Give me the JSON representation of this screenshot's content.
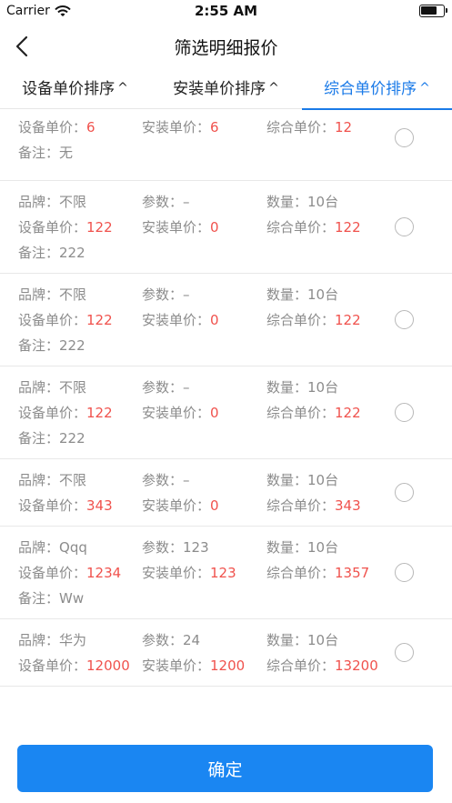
{
  "status_bar": {
    "carrier": "Carrier",
    "time": "2:55 AM",
    "battery_level": 0.75
  },
  "nav": {
    "title": "筛选明细报价"
  },
  "tabs": [
    {
      "label": "设备单价排序",
      "arrow": "^",
      "active": false
    },
    {
      "label": "安装单价排序",
      "arrow": "^",
      "active": false
    },
    {
      "label": "综合单价排序",
      "arrow": "^",
      "active": true
    }
  ],
  "labels": {
    "brand": "品牌：",
    "param": "参数：",
    "qty": "数量：",
    "equip_price": "设备单价：",
    "install_price": "安装单价：",
    "total_price": "综合单价：",
    "note": "备注："
  },
  "items": [
    {
      "brand": "",
      "param": "",
      "qty": "",
      "equip": "6",
      "install": "6",
      "total": "12",
      "note": "无",
      "partial": true
    },
    {
      "brand": "不限",
      "param": "–",
      "qty": "10台",
      "equip": "122",
      "install": "0",
      "total": "122",
      "note": "222"
    },
    {
      "brand": "不限",
      "param": "–",
      "qty": "10台",
      "equip": "122",
      "install": "0",
      "total": "122",
      "note": "222"
    },
    {
      "brand": "不限",
      "param": "–",
      "qty": "10台",
      "equip": "122",
      "install": "0",
      "total": "122",
      "note": "222"
    },
    {
      "brand": "不限",
      "param": "–",
      "qty": "10台",
      "equip": "343",
      "install": "0",
      "total": "343",
      "note": ""
    },
    {
      "brand": "Qqq",
      "param": "123",
      "qty": "10台",
      "equip": "1234",
      "install": "123",
      "total": "1357",
      "note": "Ww"
    },
    {
      "brand": "华为",
      "param": "24",
      "qty": "10台",
      "equip": "12000",
      "install": "1200",
      "total": "13200",
      "note": ""
    }
  ],
  "footer": {
    "confirm_label": "确定"
  },
  "colors": {
    "accent": "#1a7ae8",
    "price_red": "#f0524d",
    "button_blue": "#1a86f2"
  }
}
